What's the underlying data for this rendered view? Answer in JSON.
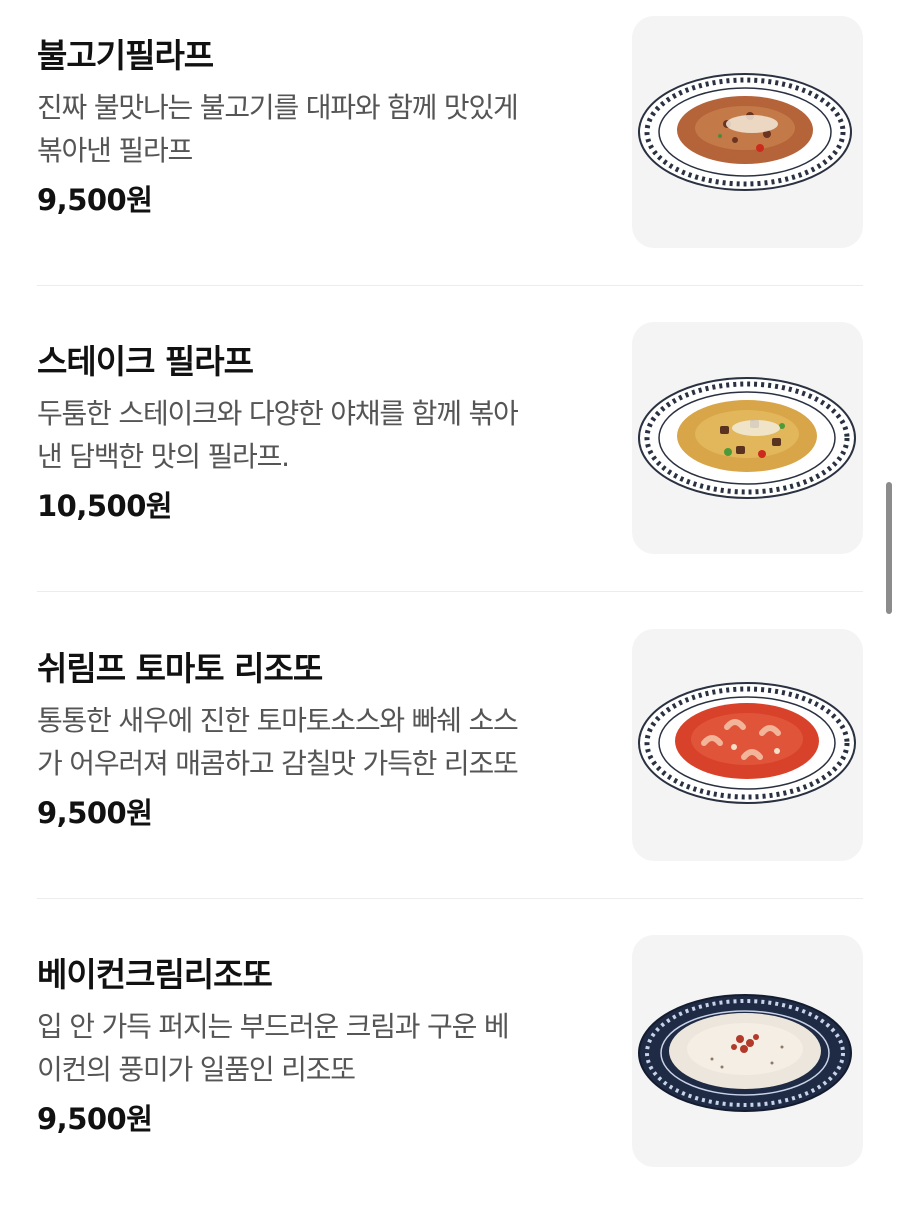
{
  "menu": {
    "items": [
      {
        "name": "불고기필라프",
        "description": "진짜 불맛나는 불고기를 대파와 함께 맛있게\n볶아낸 필라프",
        "price": "9,500원",
        "plate": "white-patterned",
        "dish_color": "#b5643a",
        "topping_color": "#6b3420"
      },
      {
        "name": "스테이크 필라프",
        "description": "두툼한 스테이크와 다양한 야채를 함께 볶아\n낸 담백한 맛의 필라프.",
        "price": "10,500원",
        "plate": "white-patterned",
        "dish_color": "#d8a548",
        "topping_color": "#5a3220"
      },
      {
        "name": "쉬림프 토마토 리조또",
        "description": "통통한 새우에 진한 토마토소스와 빠쉐 소스\n가 어우러져 매콤하고 감칠맛 가득한 리조또",
        "price": "9,500원",
        "plate": "white-patterned",
        "dish_color": "#d9422a",
        "topping_color": "#f2b59a"
      },
      {
        "name": "베이컨크림리조또",
        "description": "입 안 가득 퍼지는 부드러운 크림과 구운 베\n이컨의 풍미가 일품인 리조또",
        "price": "9,500원",
        "plate": "dark-blue-patterned",
        "dish_color": "#ece6dc",
        "topping_color": "#b23a2a"
      }
    ]
  }
}
